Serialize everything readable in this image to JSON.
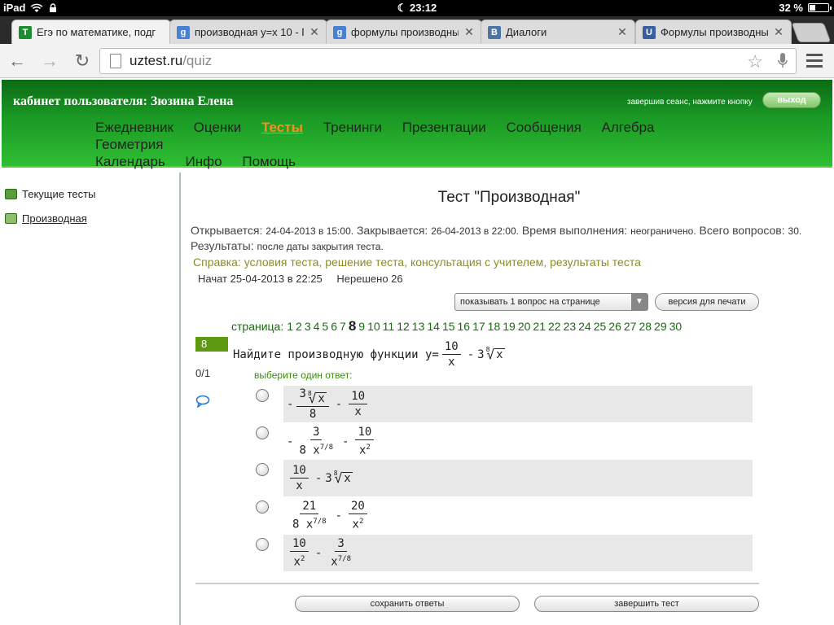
{
  "status_bar": {
    "device": "iPad",
    "time": "23:12",
    "battery": "32 %",
    "battery_level": 0.32
  },
  "tabs": [
    {
      "title": "Егэ по математике, подг",
      "favicon_color": "#1e8c33",
      "favicon_char": "Т",
      "active": true
    },
    {
      "title": "производная y=x 10 - По",
      "favicon_color": "#4a7fd6",
      "favicon_char": "g",
      "active": false
    },
    {
      "title": "формулы производных -",
      "favicon_color": "#4a7fd6",
      "favicon_char": "g",
      "active": false
    },
    {
      "title": "Диалоги",
      "favicon_color": "#4c75a3",
      "favicon_char": "В",
      "active": false
    },
    {
      "title": "Формулы производных -",
      "favicon_color": "#3a5fa0",
      "favicon_char": "U",
      "active": false
    }
  ],
  "toolbar": {
    "url_host": "uztest.ru",
    "url_path": "/quiz"
  },
  "header": {
    "cabinet": "кабинет пользователя: Зюзина Елена",
    "logout_hint": "завершив сеанс, нажмите кнопку",
    "logout": "выход",
    "nav": [
      {
        "label": "Ежедневник",
        "current": false
      },
      {
        "label": "Оценки",
        "current": false
      },
      {
        "label": "Тесты",
        "current": true
      },
      {
        "label": "Тренинги",
        "current": false
      },
      {
        "label": "Презентации",
        "current": false
      },
      {
        "label": "Сообщения",
        "current": false
      },
      {
        "label": "Алгебра",
        "current": false
      },
      {
        "label": "Геометрия",
        "current": false
      },
      {
        "label": "Календарь",
        "current": false
      },
      {
        "label": "Инфо",
        "current": false
      },
      {
        "label": "Помощь",
        "current": false
      }
    ]
  },
  "sidebar": {
    "items": [
      {
        "label": "Текущие тесты",
        "link": false
      },
      {
        "label": "Производная",
        "link": true
      }
    ]
  },
  "test": {
    "title": "Тест \"Производная\"",
    "opens_label": "Открывается:",
    "opens_value": "24-04-2013 в 15:00.",
    "closes_label": "Закрывается:",
    "closes_value": "26-04-2013 в 22:00.",
    "duration_label": "Время выполнения:",
    "duration_value": "неограничено.",
    "questions_label": "Всего вопросов:",
    "questions_value": "30.",
    "results_label": "Результаты:",
    "results_value": "после даты закрытия теста.",
    "help_label": "Справка:",
    "help_links": [
      "условия теста",
      "решение теста",
      "консультация с учителем",
      "результаты теста"
    ],
    "started": "Начат 25-04-2013 в 22:25",
    "unsolved": "Нерешено 26",
    "per_page_select": "показывать 1 вопрос на странице",
    "print_version": "версия для печати",
    "pages_label": "страница:",
    "current_page": 8,
    "total_pages": 30,
    "question_number": "8",
    "question_text": "Найдите производную функции y=",
    "score": "0/1",
    "choose_label": "выберите один ответ:",
    "save": "сохранить ответы",
    "finish": "завершить тест"
  }
}
